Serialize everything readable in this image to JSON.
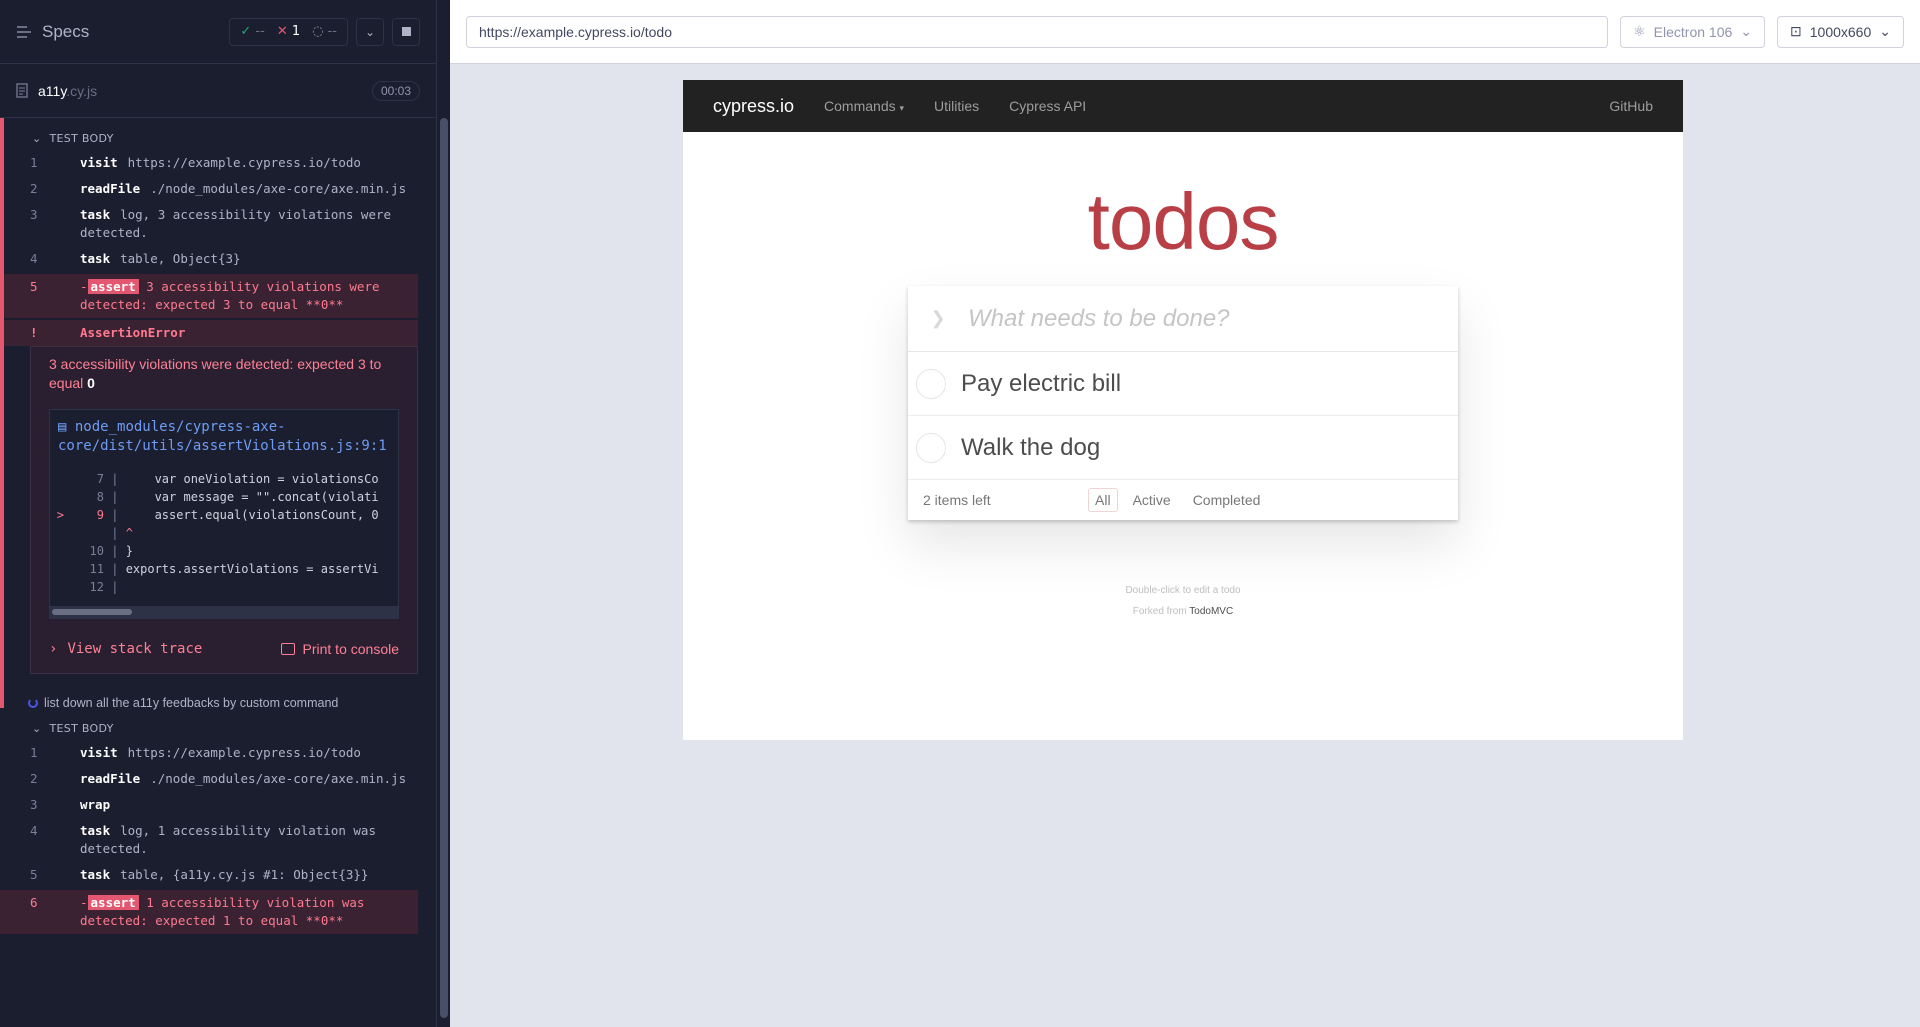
{
  "reporter": {
    "specs_label": "Specs",
    "stats": {
      "passed": "--",
      "failed": "1",
      "pending": "--"
    },
    "spec_file": {
      "name": "a11y",
      "ext": ".cy.js",
      "timer": "00:03"
    },
    "test1": {
      "section": "TEST BODY",
      "commands": [
        {
          "num": "1",
          "name": "visit",
          "msg": "https://example.cypress.io/todo"
        },
        {
          "num": "2",
          "name": "readFile",
          "msg": "./node_modules/axe-core/axe.min.js"
        },
        {
          "num": "3",
          "name": "task",
          "msg": "log, 3 accessibility violations were detected."
        },
        {
          "num": "4",
          "name": "task",
          "msg": "table, Object{3}"
        }
      ],
      "failed_cmd": {
        "num": "5",
        "prefix": "-",
        "badge": "assert",
        "msg": "3 accessibility violations were detected: expected 3 to equal **0**"
      },
      "error": {
        "mark": "!",
        "title": "AssertionError",
        "message": "3 accessibility violations were detected: expected 3 to equal",
        "message_value": "0",
        "file": "node_modules/cypress-axe-core/dist/utils/assertViolations.js:9:1",
        "code": [
          {
            "ln": "7",
            "marker": "",
            "text": "    var oneViolation = violationsCo"
          },
          {
            "ln": "8",
            "marker": "",
            "text": "    var message = \"\".concat(violati"
          },
          {
            "ln": "9",
            "marker": ">",
            "text": "    assert.equal(violationsCount, 0"
          },
          {
            "ln": "",
            "marker": "",
            "text": "^"
          },
          {
            "ln": "10",
            "marker": "",
            "text": "}"
          },
          {
            "ln": "11",
            "marker": "",
            "text": "exports.assertViolations = assertVi"
          },
          {
            "ln": "12",
            "marker": "",
            "text": ""
          }
        ],
        "view_trace": "View stack trace",
        "print_console": "Print to console"
      }
    },
    "test2": {
      "title": "list down all the a11y feedbacks by custom command",
      "section": "TEST BODY",
      "commands": [
        {
          "num": "1",
          "name": "visit",
          "msg": "https://example.cypress.io/todo"
        },
        {
          "num": "2",
          "name": "readFile",
          "msg": "./node_modules/axe-core/axe.min.js"
        },
        {
          "num": "3",
          "name": "wrap",
          "msg": ""
        },
        {
          "num": "4",
          "name": "task",
          "msg": "log, 1 accessibility violation was detected."
        },
        {
          "num": "5",
          "name": "task",
          "msg": "table, {a11y.cy.js #1: Object{3}}"
        }
      ],
      "failed_cmd": {
        "num": "6",
        "prefix": "-",
        "badge": "assert",
        "msg": "1 accessibility violation was detected: expected 1 to equal **0**"
      }
    }
  },
  "topbar": {
    "url": "https://example.cypress.io/todo",
    "browser": "Electron 106",
    "viewport": "1000x660"
  },
  "aut": {
    "brand": "cypress.io",
    "nav": {
      "commands": "Commands",
      "utilities": "Utilities",
      "api": "Cypress API",
      "github": "GitHub"
    },
    "title": "todos",
    "placeholder": "What needs to be done?",
    "todos": [
      "Pay electric bill",
      "Walk the dog"
    ],
    "items_left": "2 items left",
    "filters": [
      "All",
      "Active",
      "Completed"
    ],
    "info_line1": "Double-click to edit a todo",
    "info_line2_prefix": "Forked from",
    "info_link": "TodoMVC"
  }
}
